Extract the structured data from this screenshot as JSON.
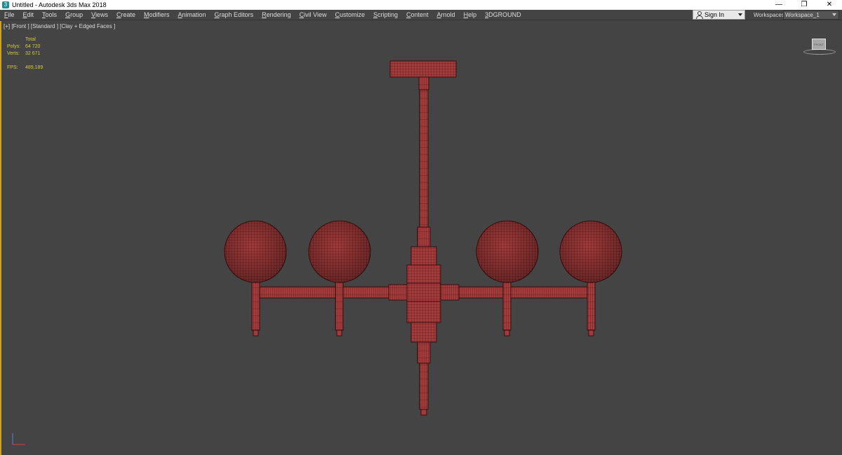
{
  "window": {
    "title": "Untitled - Autodesk 3ds Max 2018",
    "app_icon": "3"
  },
  "window_controls": {
    "minimize": "—",
    "maximize": "❐",
    "close": "✕"
  },
  "menu": [
    "File",
    "Edit",
    "Tools",
    "Group",
    "Views",
    "Create",
    "Modifiers",
    "Animation",
    "Graph Editors",
    "Rendering",
    "Civil View",
    "Customize",
    "Scripting",
    "Content",
    "Arnold",
    "Help",
    "3DGROUND"
  ],
  "account": {
    "sign_in": "Sign In"
  },
  "workspaces": {
    "label": "Workspaces:",
    "value": "Workspace_1"
  },
  "viewport": {
    "label": "[+] [Front ] [Standard ] [Clay + Edged Faces ]",
    "stats": {
      "header": "Total",
      "polys_label": "Polys:",
      "polys_value": "64 720",
      "verts_label": "Verts:",
      "verts_value": "32 671",
      "fps_label": "FPS:",
      "fps_value": "489,189"
    },
    "viewcube_face": "FRONT"
  },
  "colors": {
    "model": "#a03a3a",
    "wire": "#4a1010",
    "viewport_bg": "#444444",
    "stats": "#d6c83a",
    "active_border": "#c9a227"
  }
}
